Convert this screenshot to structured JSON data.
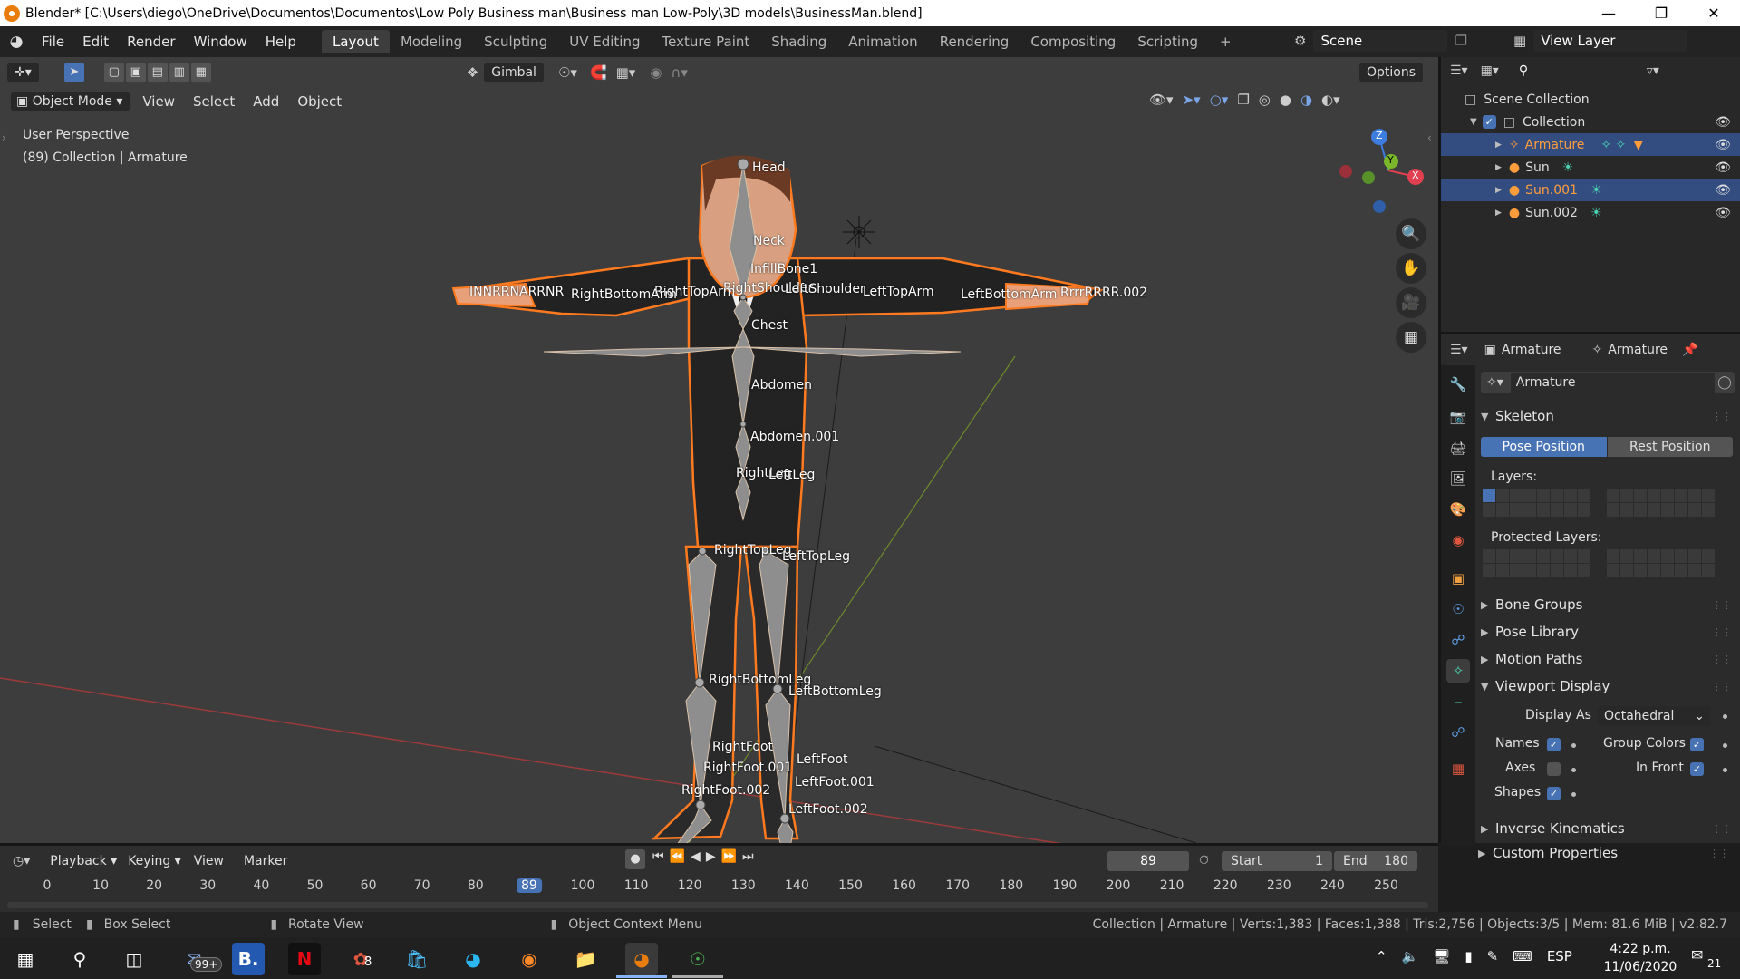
{
  "titlebar": {
    "title": "Blender* [C:\\Users\\diego\\OneDrive\\Documentos\\Documentos\\Low Poly Business man\\Business man Low-Poly\\3D models\\BusinessMan.blend]",
    "minimize": "—",
    "maximize": "❐",
    "close": "✕"
  },
  "menu": {
    "items": [
      "File",
      "Edit",
      "Render",
      "Window",
      "Help"
    ],
    "workspaces": [
      "Layout",
      "Modeling",
      "Sculpting",
      "UV Editing",
      "Texture Paint",
      "Shading",
      "Animation",
      "Rendering",
      "Compositing",
      "Scripting"
    ],
    "add_workspace": "+",
    "scene": "Scene",
    "view_layer": "View Layer"
  },
  "viewport": {
    "orientation": "Gimbal",
    "options": "Options",
    "mode": "Object Mode",
    "menus": [
      "View",
      "Select",
      "Add",
      "Object"
    ],
    "info_line1": "User Perspective",
    "info_line2": "(89) Collection | Armature",
    "gizmo": {
      "z": "Z",
      "y": "Y",
      "x": "X"
    },
    "bones": [
      "Head",
      "Neck",
      "InfillBone1",
      "RightShoulder",
      "LeftShoulder",
      "RightTopArm",
      "LeftTopArm",
      "RightBottomArm",
      "LeftBottomArm",
      "Chest",
      "Abdomen",
      "Abdomen.001",
      "RightLeg",
      "LeftLeg",
      "RightTopLeg",
      "LeftTopLeg",
      "RightBottomLeg",
      "LeftBottomLeg",
      "RightFoot",
      "RightFoot.001",
      "RightFoot.002",
      "LeftFoot",
      "LeftFoot.001",
      "LeftFoot.002",
      "INNRRNARRNR",
      "RrrrRRRR.002"
    ]
  },
  "outliner": {
    "root": "Scene Collection",
    "collection": "Collection",
    "objects": [
      {
        "name": "Armature",
        "selected": true,
        "color": "#ff9d3c"
      },
      {
        "name": "Sun",
        "selected": false,
        "color": "#dddddd"
      },
      {
        "name": "Sun.001",
        "selected": true,
        "color": "#ff9d3c"
      },
      {
        "name": "Sun.002",
        "selected": false,
        "color": "#dddddd"
      }
    ]
  },
  "properties": {
    "header_object": "Armature",
    "header_data": "Armature",
    "data_name": "Armature",
    "skeleton": "Skeleton",
    "pose_position": "Pose Position",
    "rest_position": "Rest Position",
    "layers": "Layers:",
    "protected_layers": "Protected Layers:",
    "bone_groups": "Bone Groups",
    "pose_library": "Pose Library",
    "motion_paths": "Motion Paths",
    "viewport_display": "Viewport Display",
    "display_as_label": "Display As",
    "display_as_value": "Octahedral",
    "names": "Names",
    "names_checked": true,
    "group_colors": "Group Colors",
    "group_colors_checked": true,
    "axes": "Axes",
    "axes_checked": false,
    "in_front": "In Front",
    "in_front_checked": true,
    "shapes": "Shapes",
    "shapes_checked": true,
    "inverse_kinematics": "Inverse Kinematics",
    "custom_properties": "Custom Properties"
  },
  "timeline": {
    "menus": [
      "Playback",
      "Keying",
      "View",
      "Marker"
    ],
    "current_frame": "89",
    "start_label": "Start",
    "start": "1",
    "end_label": "End",
    "end": "180",
    "ticks": [
      "0",
      "10",
      "20",
      "30",
      "40",
      "50",
      "60",
      "70",
      "80",
      "89",
      "100",
      "110",
      "120",
      "130",
      "140",
      "150",
      "160",
      "170",
      "180",
      "190",
      "200",
      "210",
      "220",
      "230",
      "240",
      "250"
    ]
  },
  "statusbar": {
    "select": "Select",
    "box_select": "Box Select",
    "rotate_view": "Rotate View",
    "context_menu": "Object Context Menu",
    "stats": "Collection | Armature | Verts:1,383 | Faces:1,388 | Tris:2,756 | Objects:3/5 | Mem: 81.6 MiB | v2.82.7"
  },
  "taskbar": {
    "mail_badge": "99+",
    "badge_8": "8",
    "language": "ESP",
    "time": "4:22 p.m.",
    "date": "11/06/2020",
    "notifications": "21"
  },
  "colors": {
    "accent": "#4772b3",
    "selection_outline": "#ff7a1f",
    "viewport_bg": "#3d3d3d"
  }
}
